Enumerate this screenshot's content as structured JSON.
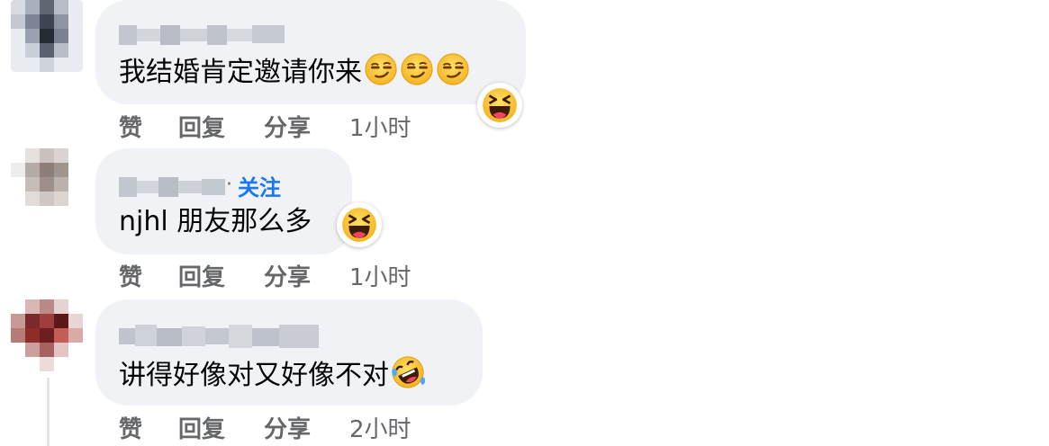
{
  "comments": [
    {
      "text": "我结婚肯定邀请你来",
      "inline_emojis": [
        "smirk-emoji",
        "smirk-emoji",
        "smirk-emoji"
      ],
      "reaction": "haha-reaction",
      "actions": {
        "like": "赞",
        "reply": "回复",
        "share": "分享",
        "time": "1小时"
      }
    },
    {
      "follow_label": "关注",
      "separator": "·",
      "text": "njhl 朋友那么多",
      "reaction": "haha-reaction",
      "actions": {
        "like": "赞",
        "reply": "回复",
        "share": "分享",
        "time": "1小时"
      }
    },
    {
      "text": "讲得好像对又好像不对",
      "inline_emojis": [
        "rofl-emoji"
      ],
      "actions": {
        "like": "赞",
        "reply": "回复",
        "share": "分享",
        "time": "2小时"
      }
    }
  ],
  "colors": {
    "bubble": "#f0f2f5",
    "follow_blue": "#1877f2",
    "secondary_text": "#65676b",
    "emoji_yellow": "#f7b125"
  }
}
